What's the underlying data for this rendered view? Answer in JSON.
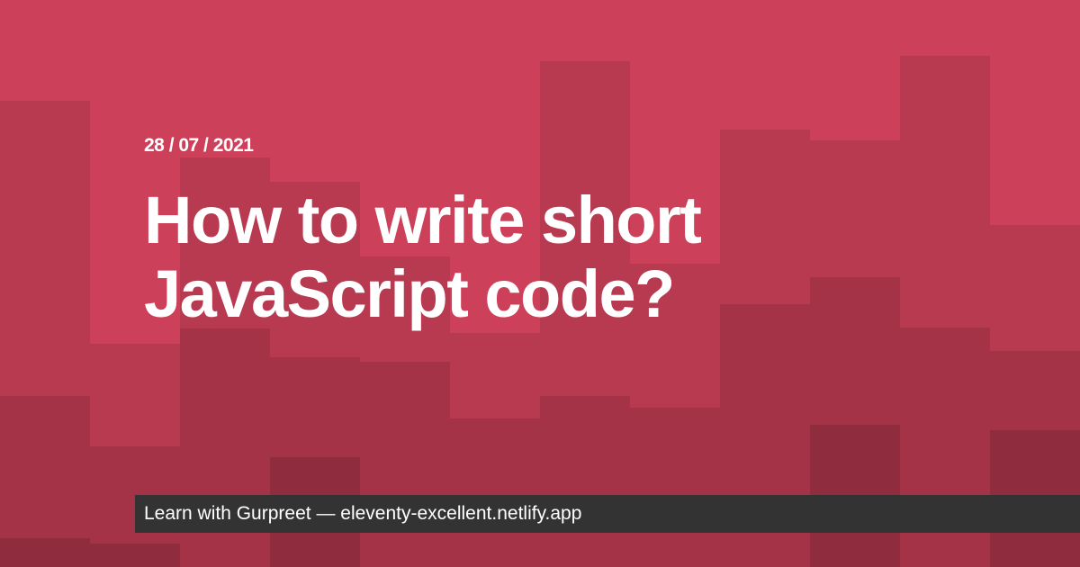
{
  "post": {
    "date": "28 / 07 / 2021",
    "title_line_1": "How to write short",
    "title_line_2": "JavaScript code?"
  },
  "footer": {
    "author": "Learn with Gurpreet",
    "separator": " — ",
    "site": "eleventy-excellent.netlify.app"
  },
  "colors": {
    "background": "#cd405a",
    "footer_background": "#333333",
    "text": "#ffffff"
  }
}
